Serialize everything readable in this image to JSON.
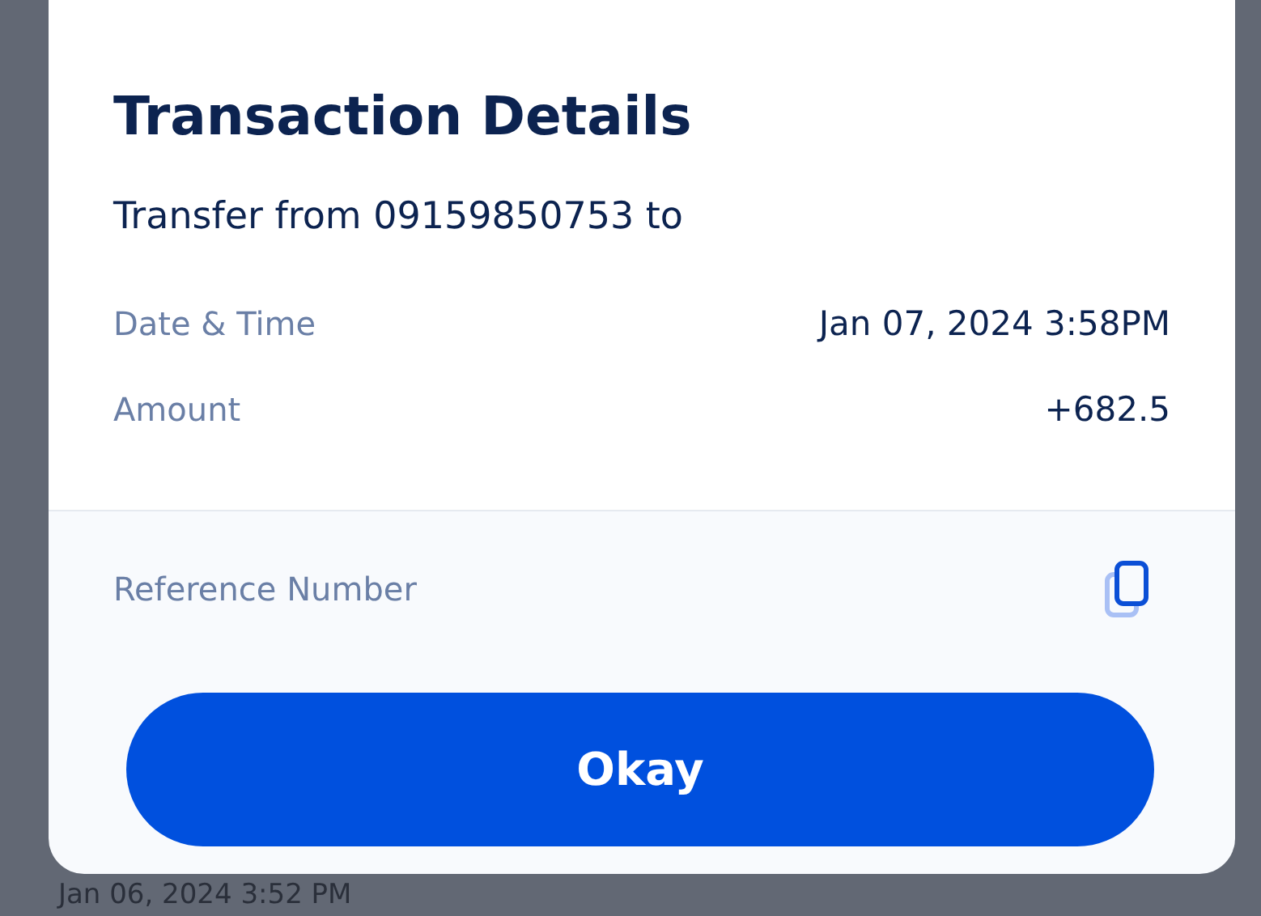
{
  "dialog": {
    "title": "Transaction Details",
    "description": "Transfer from 09159850753 to",
    "details": [
      {
        "label": "Date & Time",
        "value": "Jan 07, 2024 3:58PM"
      },
      {
        "label": "Amount",
        "value": "+682.5"
      }
    ],
    "reference": {
      "label": "Reference Number"
    },
    "button": "Okay"
  },
  "background": {
    "timestamp": "Jan 06, 2024  3:52 PM"
  }
}
